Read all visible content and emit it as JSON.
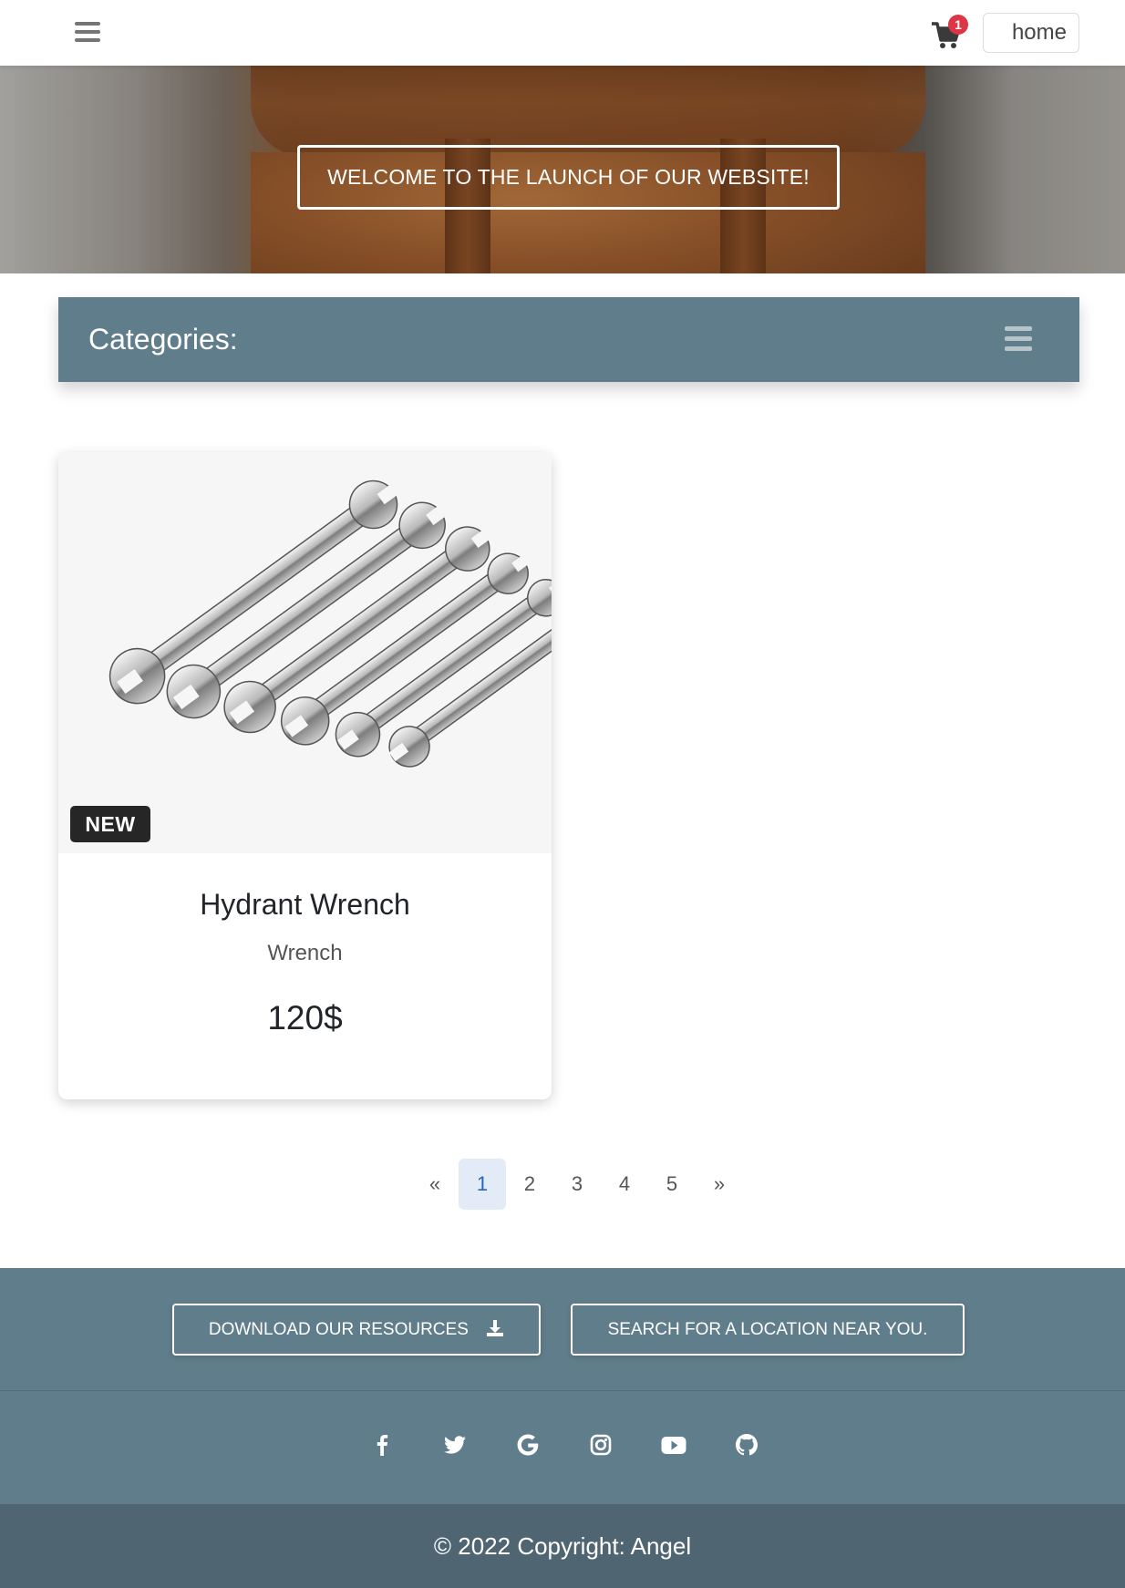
{
  "navbar": {
    "cart_count": "1",
    "home_label": "home",
    "icons": [
      "hamburger-menu-icon",
      "shopping-cart-icon"
    ]
  },
  "hero": {
    "caption": "WELCOME TO THE LAUNCH OF OUR WEBSITE!",
    "slides_total": 3,
    "active_slide": 2
  },
  "categories": {
    "title": "Categories:",
    "toggle_icon": "hamburger-menu-icon"
  },
  "products": [
    {
      "badge": "NEW",
      "name": "Hydrant Wrench",
      "category": "Wrench",
      "price": "120$",
      "image": "wrench-set-image"
    }
  ],
  "pagination": {
    "prev": "«",
    "pages": [
      "1",
      "2",
      "3",
      "4",
      "5"
    ],
    "active": "1",
    "next": "»"
  },
  "footer": {
    "download_label": "DOWNLOAD OUR RESOURCES",
    "search_label": "SEARCH FOR A LOCATION NEAR YOU.",
    "social_icons": [
      "facebook-icon",
      "twitter-icon",
      "google-icon",
      "instagram-icon",
      "youtube-icon",
      "github-icon"
    ],
    "copyright": "© 2022 Copyright: Angel"
  },
  "colors": {
    "primary": "#607d8b",
    "footer_bottom": "#4f6672",
    "cart_badge": "#dc3545",
    "new_badge": "#262626",
    "active_page_bg": "#e3ebf7"
  }
}
